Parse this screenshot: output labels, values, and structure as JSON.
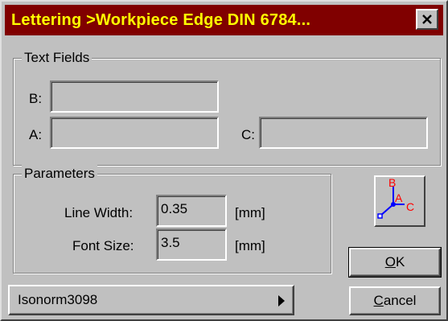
{
  "window": {
    "title": "Lettering >Workpiece Edge DIN 6784...",
    "close_glyph": "✕"
  },
  "text_fields": {
    "group_label": "Text Fields",
    "b_label": "B:",
    "a_label": "A:",
    "c_label": "C:",
    "b_value": "",
    "a_value": "",
    "c_value": ""
  },
  "parameters": {
    "group_label": "Parameters",
    "line_width_label": "Line Width:",
    "line_width_value": "0.35",
    "line_width_unit": "[mm]",
    "font_size_label": "Font Size:",
    "font_size_value": "3.5",
    "font_size_unit": "[mm]"
  },
  "buttons": {
    "ok_label_underlined": "O",
    "ok_label_rest": "K",
    "cancel_label_underlined": "C",
    "cancel_label_rest": "ancel"
  },
  "template_selector": {
    "value": "Isonorm3098"
  },
  "axis_icon": {
    "name": "edge-axes-icon",
    "labels": {
      "a": "A",
      "b": "B",
      "c": "C"
    },
    "colors": {
      "axes": "#0000ff",
      "letters": "#ff0000",
      "dot": "#0000ff"
    }
  },
  "colors": {
    "titlebar_bg": "#800000",
    "titlebar_text": "#ffff00",
    "face": "#c0c0c0"
  }
}
